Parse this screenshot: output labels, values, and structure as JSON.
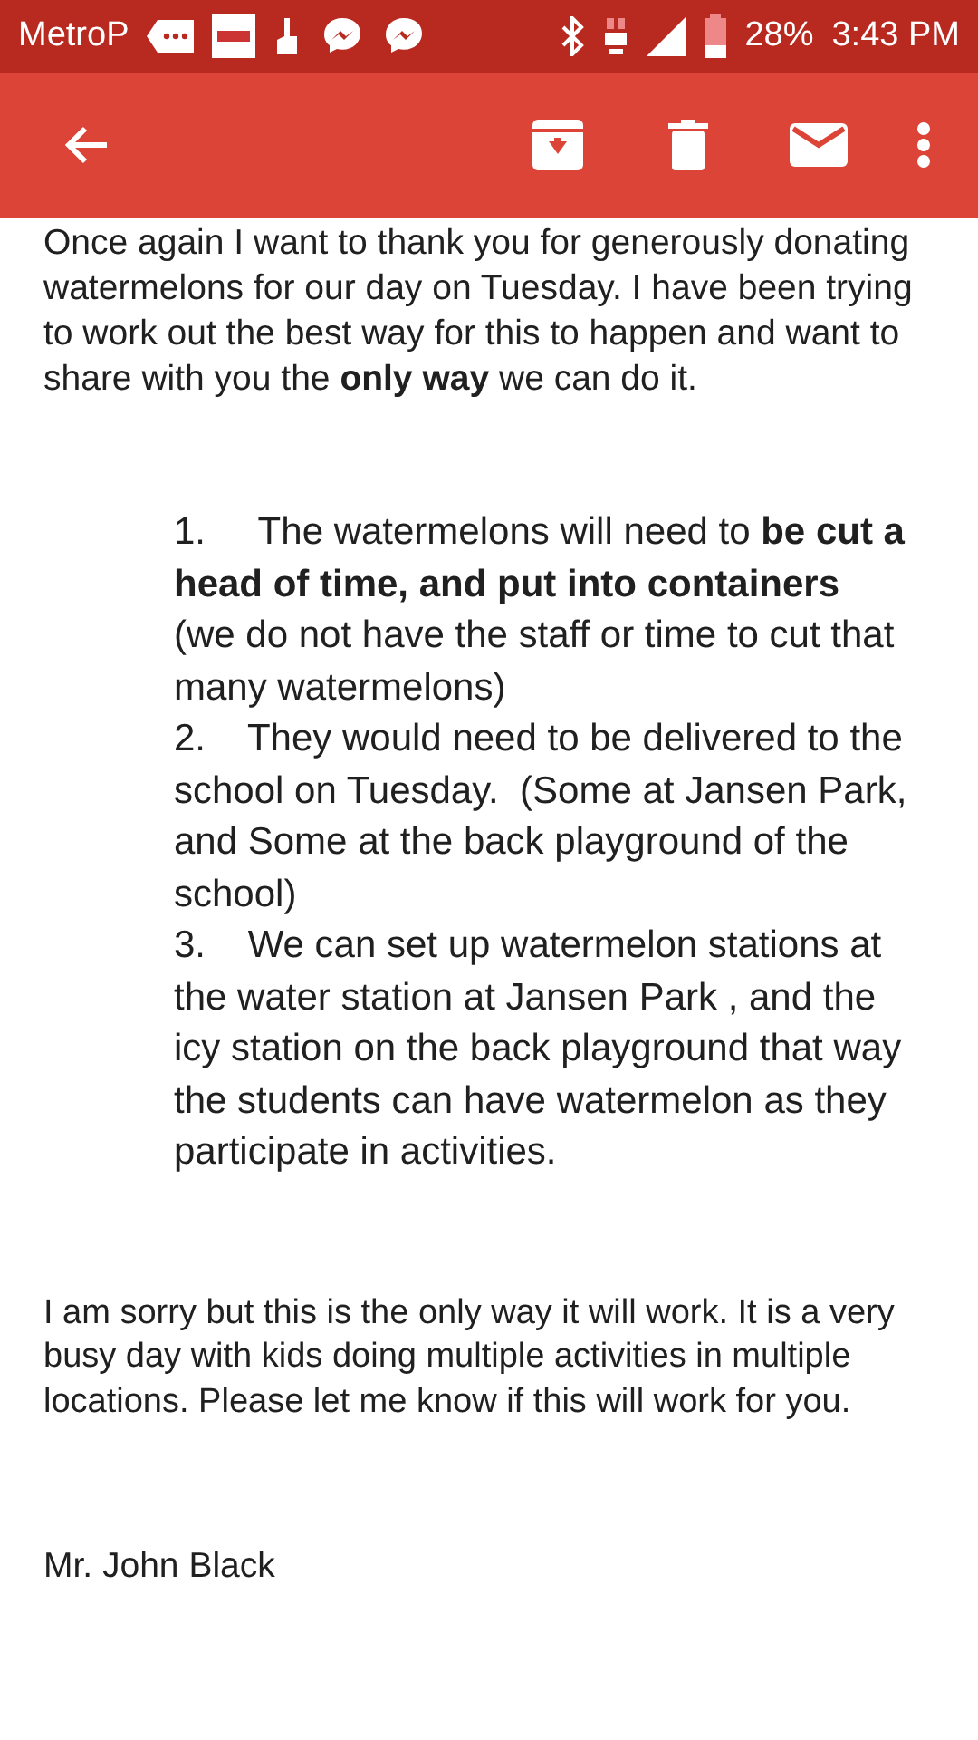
{
  "status_bar": {
    "carrier": "MetroP",
    "battery": "28%",
    "time": "3:43 PM"
  },
  "message": {
    "intro": "Once again I want to thank you for generously donating watermelons for our day on Tuesday.  I have been trying to work out the best way for this to happen and want to share with you the **only way** we can do it.",
    "list": [
      {
        "text": "1.     The watermelons will need to **be cut a head of time, and put into containers**   (we do not have the staff or time to cut that many watermelons)"
      },
      {
        "text": "2.    They would need to be delivered to the school on Tuesday.  (Some at Jansen Park, and Some at the back playground of the school)"
      },
      {
        "text": "3.    We can set up watermelon stations at the water station at Jansen Park , and the icy station on the back playground that way the students can have watermelon as they participate in activities."
      }
    ],
    "closing": "I am sorry but this is the only way it will work.  It is a very busy day with kids doing multiple activities in multiple locations.  Please let me know if this will work for you.",
    "signature": "Mr. John Black"
  }
}
